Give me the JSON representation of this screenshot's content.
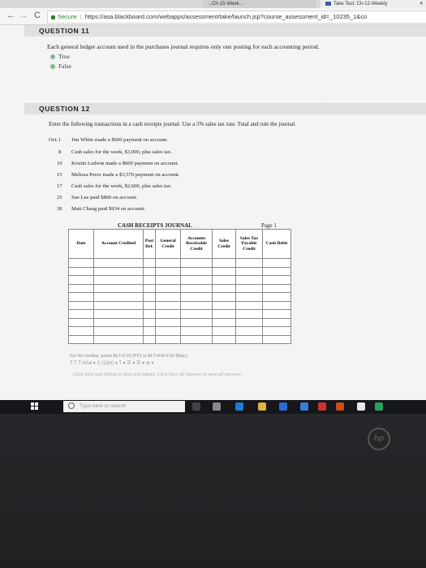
{
  "browser": {
    "tabs": [
      {
        "label": "...Ch-15-Week..."
      },
      {
        "label": "Take Test: Ch-12-Weekly",
        "close": "×"
      }
    ],
    "secure_label": "Secure",
    "url": "https://asa.blackboard.com/webapps/assessment/take/launch.jsp?course_assessment_id=_10235_1&co"
  },
  "question11": {
    "heading": "QUESTION 11",
    "prompt": "Each general ledger account used in the purchases journal requires only one posting for each accounting period.",
    "options": [
      "True",
      "False"
    ],
    "selected": "False"
  },
  "question12": {
    "heading": "QUESTION 12",
    "prompt": "Enter the following transactions in a cash receipts journal. Use a 5% sales tax rate. Total and rule the journal.",
    "transactions": [
      {
        "month": "Oct.",
        "day": "1",
        "text": "Jim White made a $600 payment on account."
      },
      {
        "month": "",
        "day": "8",
        "text": "Cash sales for the week, $3,000, plus sales tax."
      },
      {
        "month": "",
        "day": "10",
        "text": "Kristin Ludwin made a $600 payment on account."
      },
      {
        "month": "",
        "day": "15",
        "text": "Melissa Perez made a $3,570 payment on account."
      },
      {
        "month": "",
        "day": "17",
        "text": "Cash sales for the week, $2,600, plus sales tax."
      },
      {
        "month": "",
        "day": "25",
        "text": "Sue Lee paid $860 on account."
      },
      {
        "month": "",
        "day": "30",
        "text": "Matt Chang paid $934 on account."
      }
    ],
    "journal": {
      "title": "CASH RECEIPTS JOURNAL",
      "page": "Page 1",
      "columns": [
        {
          "label": "Date"
        },
        {
          "label": "Account Credited"
        },
        {
          "label": "Post Ref."
        },
        {
          "label": "General Credit"
        },
        {
          "label": "Accounts Receivable Credit"
        },
        {
          "label": "Sales Credit"
        },
        {
          "label": "Sales Tax Payable Credit"
        },
        {
          "label": "Cash Debit"
        }
      ],
      "empty_rows": 10
    },
    "toolbar_hint": "For the toolbar, press ALT+F10 (PC) or ALT+FN+F10 (Mac).",
    "toolbar_icons": "T  T  T   Arial    ▾  3 (12pt)  ▾  T ▾  ☰ ▾  ☰ ▾  ⊕ ▾",
    "save_hint": "Click Save and Submit to save and submit. Click Save All Answers to save all answers."
  },
  "taskbar": {
    "search_placeholder": "Type here to search"
  },
  "logo": "hp",
  "colors": {
    "accent_radio": "#7dbd8a",
    "taskbar": "#15171b"
  }
}
